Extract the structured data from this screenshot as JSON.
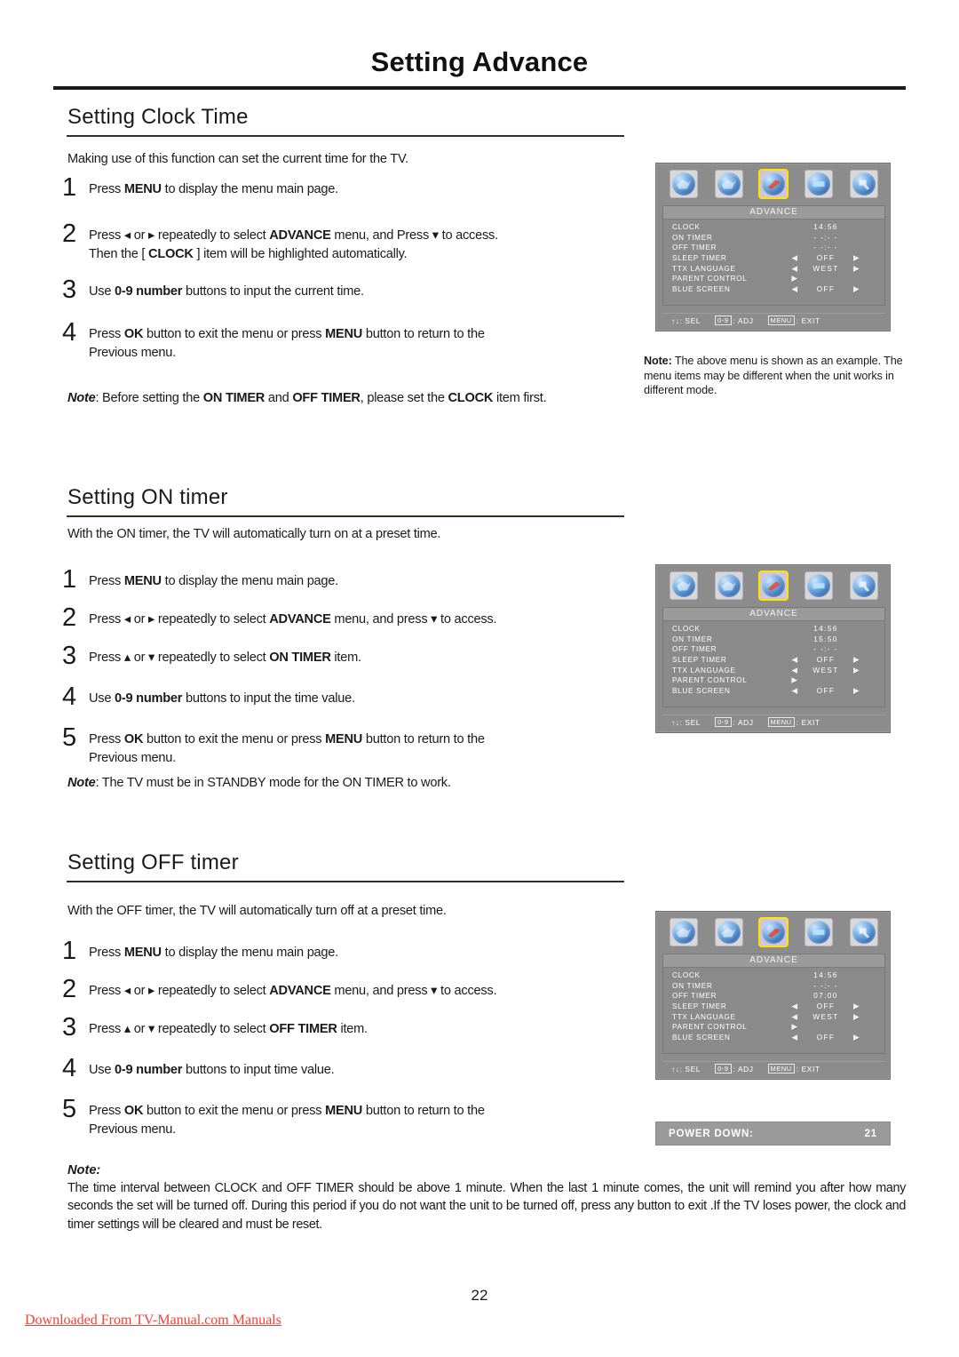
{
  "header": {
    "title": "Setting Advance"
  },
  "sections": [
    {
      "heading": "Setting Clock Time",
      "intro": "Making use of this function can set the current time for the TV.",
      "steps": [
        {
          "num": "1",
          "html": "Press  <b>MENU</b> to display the menu main page."
        },
        {
          "num": "2",
          "html": "Press &#9666; or &#9656; repeatedly to select <b>ADVANCE</b> menu, and Press &#9662; to access.<br>Then the [ <b>CLOCK</b> ] item will be highlighted automatically."
        },
        {
          "num": "3",
          "html": "Use <b>0-9 number</b> buttons to input the current time."
        },
        {
          "num": "4",
          "html": "Press <b>OK</b> button to exit the menu  or press <b>MENU</b>  button to return to the<br>Previous menu."
        }
      ],
      "note": "<i>Note</i>: Before setting the <b>ON TIMER</b> and <b>OFF TIMER</b>, please set the <b>CLOCK</b> item first."
    },
    {
      "heading": "Setting ON timer",
      "intro": "With the ON timer, the TV will automatically turn on at a preset time.",
      "steps": [
        {
          "num": "1",
          "html": "Press  <b>MENU</b> to display the menu main page."
        },
        {
          "num": "2",
          "html": "Press &#9666; or &#9656; repeatedly to select <b>ADVANCE</b> menu, and press &#9662; to access."
        },
        {
          "num": "3",
          "html": "Press  &#9652; or &#9662; repeatedly to select <b>ON TIMER</b> item."
        },
        {
          "num": "4",
          "html": "Use <b>0-9 number</b> buttons to input the time value."
        },
        {
          "num": "5",
          "html": "Press <b>OK</b> button to exit the menu  or press <b>MENU</b>  button to return to the<br>Previous menu."
        }
      ],
      "note": "<i>Note</i>: The TV must be in STANDBY mode for the ON TIMER to work."
    },
    {
      "heading": "Setting OFF timer",
      "intro": "With the OFF timer, the TV will automatically turn off at a preset time.",
      "steps": [
        {
          "num": "1",
          "html": "Press  <b>MENU</b> to display the menu main page."
        },
        {
          "num": "2",
          "html": "Press &#9666; or &#9656; repeatedly to select <b>ADVANCE</b> menu, and press &#9662; to access."
        },
        {
          "num": "3",
          "html": "Press  &#9652; or &#9662; repeatedly to select  <b>OFF TIMER</b>  item."
        },
        {
          "num": "4",
          "html": "Use <b>0-9 number</b> buttons to input time value."
        },
        {
          "num": "5",
          "html": "Press <b>OK</b> button to exit the menu  or press <b>MENU</b>  button to return to the<br>Previous menu."
        }
      ],
      "note": ""
    }
  ],
  "side_note": {
    "label": "Note:",
    "text": "The above menu is shown as an example. The menu items may be different when the unit works in different mode."
  },
  "osd_common": {
    "menu_title": "ADVANCE",
    "icons": [
      {
        "name": "picture-icon",
        "style": "picture"
      },
      {
        "name": "sound-icon",
        "style": "sound"
      },
      {
        "name": "advance-icon",
        "style": "wrench"
      },
      {
        "name": "screen-icon",
        "style": "screen"
      },
      {
        "name": "search-icon",
        "style": "glass"
      }
    ],
    "selected_icon_index": 2,
    "footer": {
      "sel_keys": "↑↓",
      "sel_label": ": SEL",
      "adj_key": "0-9",
      "adj_label": ": ADJ",
      "exit_key": "MENU",
      "exit_label": ": EXIT"
    },
    "arrow_left": "◀",
    "arrow_right": "▶",
    "highlight_color": "#ffe400"
  },
  "osd_screens": [
    {
      "id": "osd-clock",
      "rows": [
        {
          "label": "CLOCK",
          "value": "14:56",
          "left": "",
          "right": ""
        },
        {
          "label": "ON TIMER",
          "value": "- -:- -",
          "left": "",
          "right": ""
        },
        {
          "label": "OFF TIMER",
          "value": "- -:- -",
          "left": "",
          "right": ""
        },
        {
          "label": "SLEEP TIMER",
          "value": "OFF",
          "left": "◀",
          "right": "▶"
        },
        {
          "label": "TTX LANGUAGE",
          "value": "WEST",
          "left": "◀",
          "right": "▶"
        },
        {
          "label": "PARENT CONTROL",
          "value": "",
          "left": "▶",
          "right": ""
        },
        {
          "label": "BLUE SCREEN",
          "value": "OFF",
          "left": "◀",
          "right": "▶"
        }
      ]
    },
    {
      "id": "osd-on-timer",
      "rows": [
        {
          "label": "CLOCK",
          "value": "14:56",
          "left": "",
          "right": ""
        },
        {
          "label": "ON TIMER",
          "value": "15:50",
          "left": "",
          "right": ""
        },
        {
          "label": "OFF TIMER",
          "value": "- -:- -",
          "left": "",
          "right": ""
        },
        {
          "label": "SLEEP TIMER",
          "value": "OFF",
          "left": "◀",
          "right": "▶"
        },
        {
          "label": "TTX LANGUAGE",
          "value": "WEST",
          "left": "◀",
          "right": "▶"
        },
        {
          "label": "PARENT CONTROL",
          "value": "",
          "left": "▶",
          "right": ""
        },
        {
          "label": "BLUE SCREEN",
          "value": "OFF",
          "left": "◀",
          "right": "▶"
        }
      ]
    },
    {
      "id": "osd-off-timer",
      "rows": [
        {
          "label": "CLOCK",
          "value": "14:56",
          "left": "",
          "right": ""
        },
        {
          "label": "ON TIMER",
          "value": "- -:- -",
          "left": "",
          "right": ""
        },
        {
          "label": "OFF TIMER",
          "value": "07:00",
          "left": "",
          "right": ""
        },
        {
          "label": "SLEEP TIMER",
          "value": "OFF",
          "left": "◀",
          "right": "▶"
        },
        {
          "label": "TTX LANGUAGE",
          "value": "WEST",
          "left": "◀",
          "right": "▶"
        },
        {
          "label": "PARENT CONTROL",
          "value": "",
          "left": "▶",
          "right": ""
        },
        {
          "label": "BLUE SCREEN",
          "value": "OFF",
          "left": "◀",
          "right": "▶"
        }
      ]
    }
  ],
  "power_bar": {
    "label": "POWER  DOWN:",
    "value": "21"
  },
  "bottom_note": {
    "header": "Note:",
    "text": "The time interval between CLOCK and OFF TIMER should be above 1 minute. When the last 1 minute comes, the unit will remind you after how many seconds the set will be turned off. During this period if you do not want the unit to be turned off, press any button to exit .If the TV loses power, the clock and timer settings will be cleared and must be reset."
  },
  "footer": {
    "page_number": "22",
    "download_text": "Downloaded From TV-Manual.com Manuals"
  }
}
